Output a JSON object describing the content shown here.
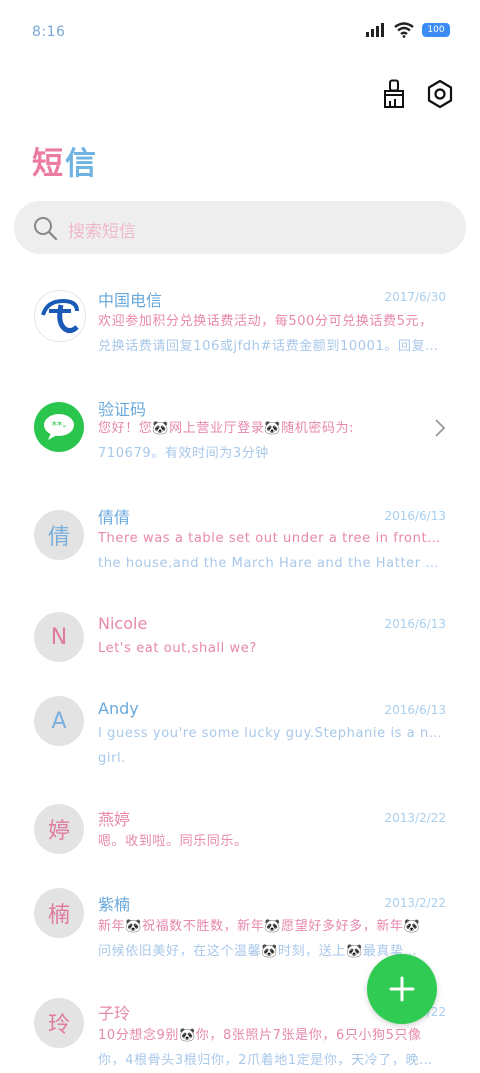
{
  "status_bar": {
    "time": "8:16",
    "battery": "100"
  },
  "header": {
    "title_part1": "短",
    "title_part2": "信"
  },
  "search": {
    "placeholder": "搜索短信"
  },
  "conversations": [
    {
      "name": "中国电信",
      "date": "2017/6/30",
      "line1": "欢迎参加积分兑换话费活动，每500分可兑换话费5元，",
      "line2": "兑换话费请回复106或jfdh#话费金额到10001。回复…",
      "avatar": "china-telecom-logo"
    },
    {
      "name": "验证码",
      "date": "",
      "line1": "您好！您🐼网上营业厅登录🐼随机密码为:",
      "line2": "710679。有效时间为3分钟",
      "avatar": "message-bubble-icon"
    },
    {
      "name": "倩倩",
      "date": "2016/6/13",
      "line1": "There was a table set out under a tree in front of",
      "line2": "the house,and the March Hare and the Hatter wer…",
      "avatar_text": "倩"
    },
    {
      "name": "Nicole",
      "date": "2016/6/13",
      "line1": "Let's eat out,shall we?",
      "line2": "",
      "avatar_text": "N"
    },
    {
      "name": "Andy",
      "date": "2016/6/13",
      "line1": "I guess you're some lucky guy.Stephanie is a nice",
      "line2": "girl.",
      "avatar_text": "A"
    },
    {
      "name": "燕婷",
      "date": "2013/2/22",
      "line1": "嗯。收到啦。同乐同乐。",
      "line2": "",
      "avatar_text": "婷"
    },
    {
      "name": "紫楠",
      "date": "2013/2/22",
      "line1": "新年🐼祝福数不胜数，新年🐼愿望好多好多，新年🐼",
      "line2": "问候依旧美好，在这个温馨🐼时刻，送上🐼最真挚…",
      "avatar_text": "楠"
    },
    {
      "name": "子玲",
      "date": "2013/2/22",
      "line1": "10分想念9别🐼你，8张照片7张是你，6只小狗5只像",
      "line2": "你，4根骨头3根归你，2爪着地1定是你，天冷了，晚…",
      "avatar_text": "玲"
    }
  ],
  "colors": {
    "fab": "#2fcb52",
    "pink": "#e888ad",
    "blue": "#6aa9dc"
  }
}
